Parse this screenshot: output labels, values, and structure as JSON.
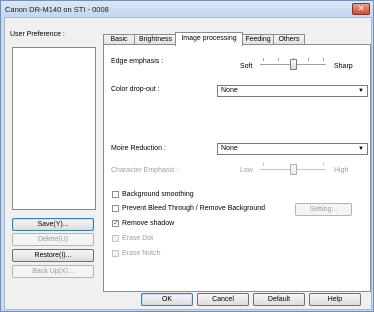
{
  "window": {
    "title": "Canon DR-M140 on STI - 0008",
    "close_glyph": "✕"
  },
  "user_preference": {
    "label": "User Preference :",
    "items": [],
    "buttons": [
      {
        "label": "Save(Y)...",
        "enabled": true
      },
      {
        "label": "Delete(U)",
        "enabled": false
      },
      {
        "label": "Restore(I)...",
        "enabled": true
      },
      {
        "label": "Back Up(X)...",
        "enabled": false
      }
    ]
  },
  "tabs": [
    {
      "label": "Basic",
      "active": false
    },
    {
      "label": "Brightness",
      "active": false
    },
    {
      "label": "Image processing",
      "active": true
    },
    {
      "label": "Feeding",
      "active": false
    },
    {
      "label": "Others",
      "active": false
    }
  ],
  "image_processing": {
    "edge_emphasis": {
      "label": "Edge emphasis :",
      "min_label": "Soft",
      "max_label": "Sharp",
      "value_fraction": 0.5
    },
    "color_dropout": {
      "label": "Color drop-out :",
      "value": "None"
    },
    "moire_reduction": {
      "label": "Moire Reduction :",
      "value": "None"
    },
    "character_emphasis": {
      "label": "Character Emphasis :",
      "min_label": "Low",
      "max_label": "High",
      "value_fraction": 0.5,
      "enabled": false
    },
    "options": [
      {
        "label": "Background smoothing",
        "checked": false,
        "enabled": true
      },
      {
        "label": "Prevent Bleed Through / Remove Background",
        "checked": false,
        "enabled": true
      },
      {
        "label": "Remove shadow",
        "checked": true,
        "enabled": true
      },
      {
        "label": "Erase Dot",
        "checked": false,
        "enabled": false
      },
      {
        "label": "Erase Notch",
        "checked": false,
        "enabled": false
      }
    ],
    "setting_button": "Setting..."
  },
  "footer": {
    "ok": "OK",
    "cancel": "Cancel",
    "default": "Default",
    "help": "Help"
  },
  "icons": {
    "check": "✓",
    "dropdown": "▼"
  }
}
